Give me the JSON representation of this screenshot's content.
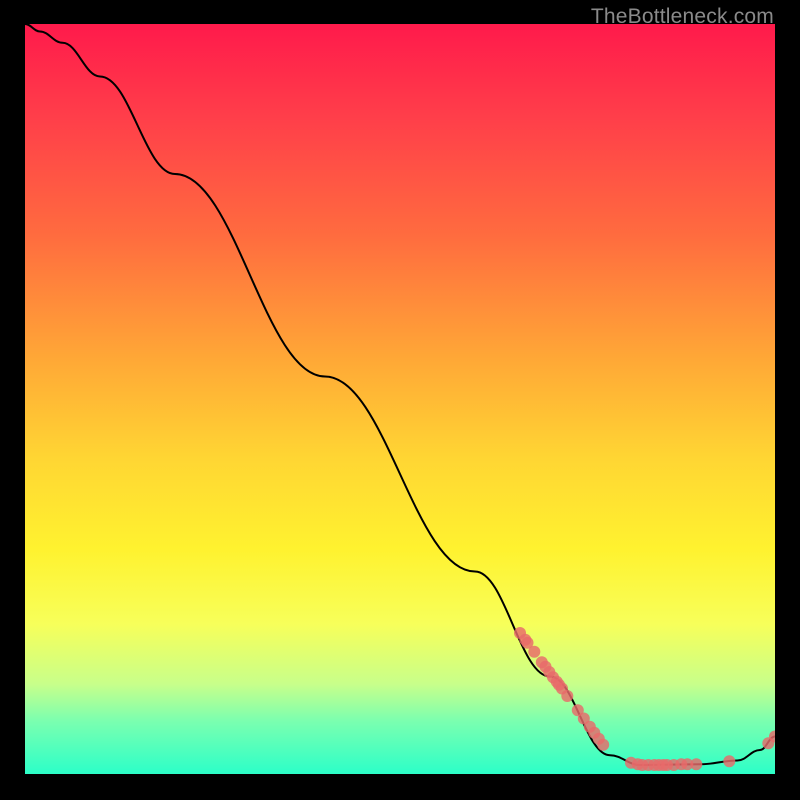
{
  "watermark": "TheBottleneck.com",
  "chart_data": {
    "type": "line",
    "title": "",
    "xlabel": "",
    "ylabel": "",
    "xlim": [
      0,
      100
    ],
    "ylim": [
      0,
      100
    ],
    "series": [
      {
        "name": "bottleneck-curve",
        "curve": [
          {
            "x": 0,
            "y": 100
          },
          {
            "x": 2,
            "y": 99
          },
          {
            "x": 5,
            "y": 97.5
          },
          {
            "x": 10,
            "y": 93
          },
          {
            "x": 20,
            "y": 80
          },
          {
            "x": 40,
            "y": 53
          },
          {
            "x": 60,
            "y": 27
          },
          {
            "x": 70,
            "y": 13
          },
          {
            "x": 78,
            "y": 2.5
          },
          {
            "x": 82,
            "y": 1.2
          },
          {
            "x": 90,
            "y": 1.3
          },
          {
            "x": 95,
            "y": 1.8
          },
          {
            "x": 98,
            "y": 3.2
          },
          {
            "x": 100,
            "y": 5
          }
        ]
      },
      {
        "name": "marker-dots",
        "points": [
          {
            "x": 66,
            "y": 18.8
          },
          {
            "x": 66.7,
            "y": 17.9
          },
          {
            "x": 67,
            "y": 17.5
          },
          {
            "x": 67.9,
            "y": 16.3
          },
          {
            "x": 68.9,
            "y": 14.9
          },
          {
            "x": 69.4,
            "y": 14.3
          },
          {
            "x": 69.9,
            "y": 13.6
          },
          {
            "x": 70.4,
            "y": 12.9
          },
          {
            "x": 70.9,
            "y": 12.3
          },
          {
            "x": 71.2,
            "y": 11.9
          },
          {
            "x": 71.6,
            "y": 11.4
          },
          {
            "x": 72.3,
            "y": 10.4
          },
          {
            "x": 73.7,
            "y": 8.5
          },
          {
            "x": 74.5,
            "y": 7.4
          },
          {
            "x": 75.3,
            "y": 6.3
          },
          {
            "x": 75.9,
            "y": 5.5
          },
          {
            "x": 76.5,
            "y": 4.7
          },
          {
            "x": 77.1,
            "y": 3.9
          },
          {
            "x": 80.8,
            "y": 1.5
          },
          {
            "x": 81.7,
            "y": 1.3
          },
          {
            "x": 82.3,
            "y": 1.2
          },
          {
            "x": 83.1,
            "y": 1.2
          },
          {
            "x": 83.9,
            "y": 1.2
          },
          {
            "x": 84.5,
            "y": 1.2
          },
          {
            "x": 85.1,
            "y": 1.2
          },
          {
            "x": 85.6,
            "y": 1.2
          },
          {
            "x": 86.5,
            "y": 1.2
          },
          {
            "x": 87.5,
            "y": 1.3
          },
          {
            "x": 88.3,
            "y": 1.3
          },
          {
            "x": 89.5,
            "y": 1.3
          },
          {
            "x": 93.9,
            "y": 1.7
          },
          {
            "x": 99.1,
            "y": 4.1
          },
          {
            "x": 100,
            "y": 5
          }
        ]
      }
    ]
  }
}
